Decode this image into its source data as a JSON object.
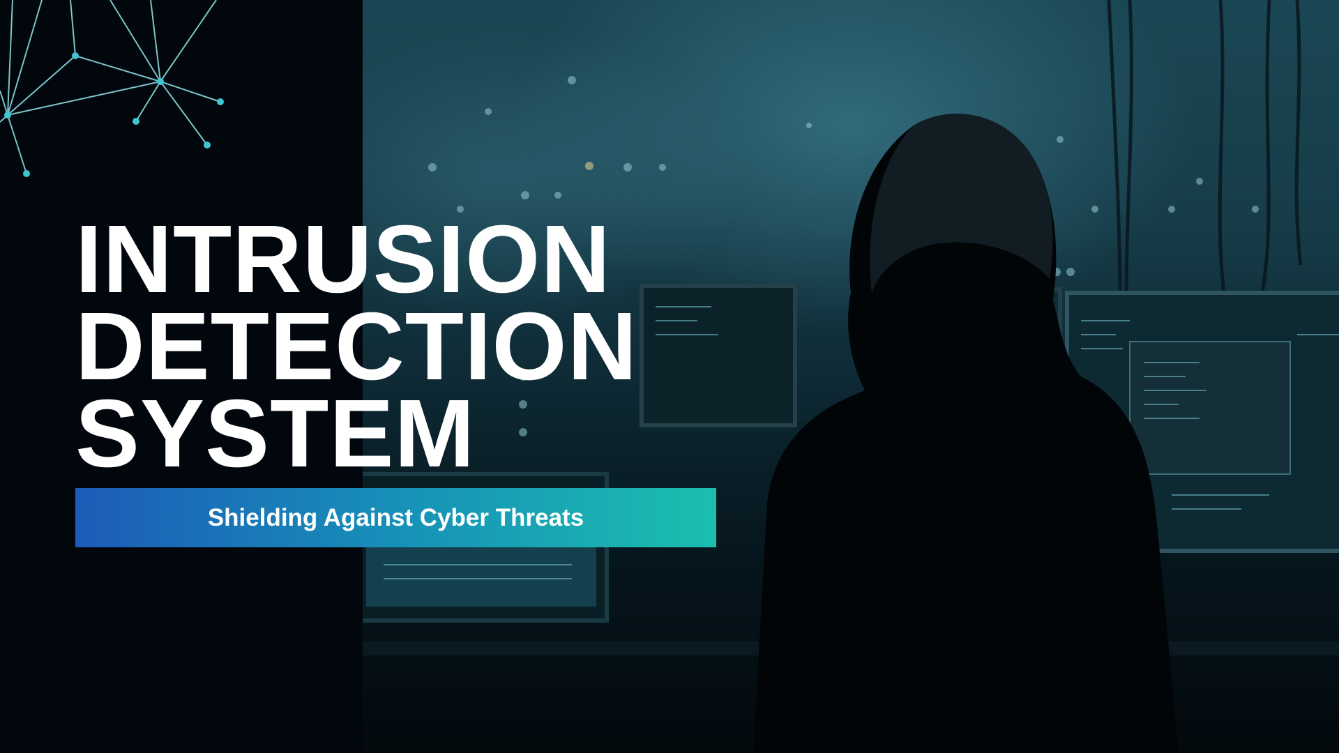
{
  "slide": {
    "title_lines": [
      "INTRUSION",
      "DETECTION",
      "SYSTEM"
    ],
    "subtitle": "Shielding Against Cyber Threats"
  },
  "colors": {
    "background": "#02060d",
    "network_accent": "#3ec6d0",
    "banner_start": "#1d5bb8",
    "banner_end": "#1bbfae",
    "title_text": "#ffffff"
  },
  "icons": [
    "network-graph-icon"
  ],
  "image": {
    "subject": "hooded-hacker-at-monitors"
  }
}
